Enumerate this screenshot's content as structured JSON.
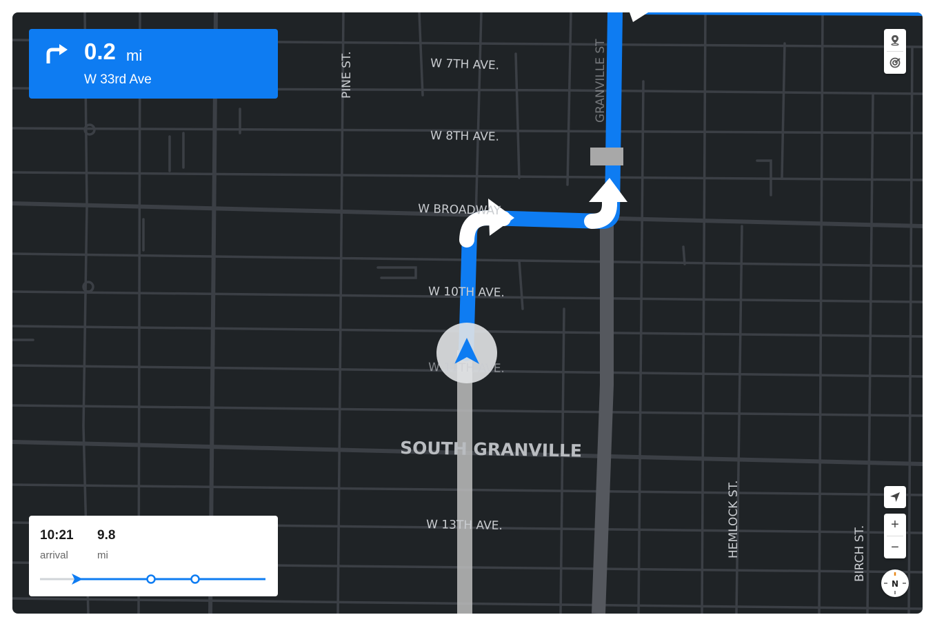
{
  "navigation": {
    "turn_icon": "turn-right-icon",
    "distance_value": "0.2",
    "distance_unit": "mi",
    "street": "W 33rd Ave"
  },
  "map": {
    "street_labels": [
      "W 7TH AVE.",
      "PINE ST.",
      "W 8TH AVE.",
      "W BROADWAY",
      "W 10TH AVE.",
      "W 11TH AVE.",
      "W 13TH AVE.",
      "HEMLOCK ST.",
      "BIRCH ST.",
      "GRANVILLE ST"
    ],
    "neighborhood": "SOUTH GRANVILLE",
    "colors": {
      "background": "#1f2326",
      "road": "#3b3f45",
      "route": "#0e7cf2",
      "traveled_route": "#c8c8c8"
    }
  },
  "trip": {
    "arrival_time": "10:21",
    "arrival_label": "arrival",
    "distance_remaining": "9.8",
    "distance_label": "mi"
  },
  "controls": {
    "top": [
      "pin-icon",
      "radar-icon"
    ],
    "bottom": [
      "locate-icon",
      "zoom-in-icon",
      "zoom-out-icon"
    ],
    "zoom_in_label": "+",
    "zoom_out_label": "−",
    "compass_label": "N"
  }
}
